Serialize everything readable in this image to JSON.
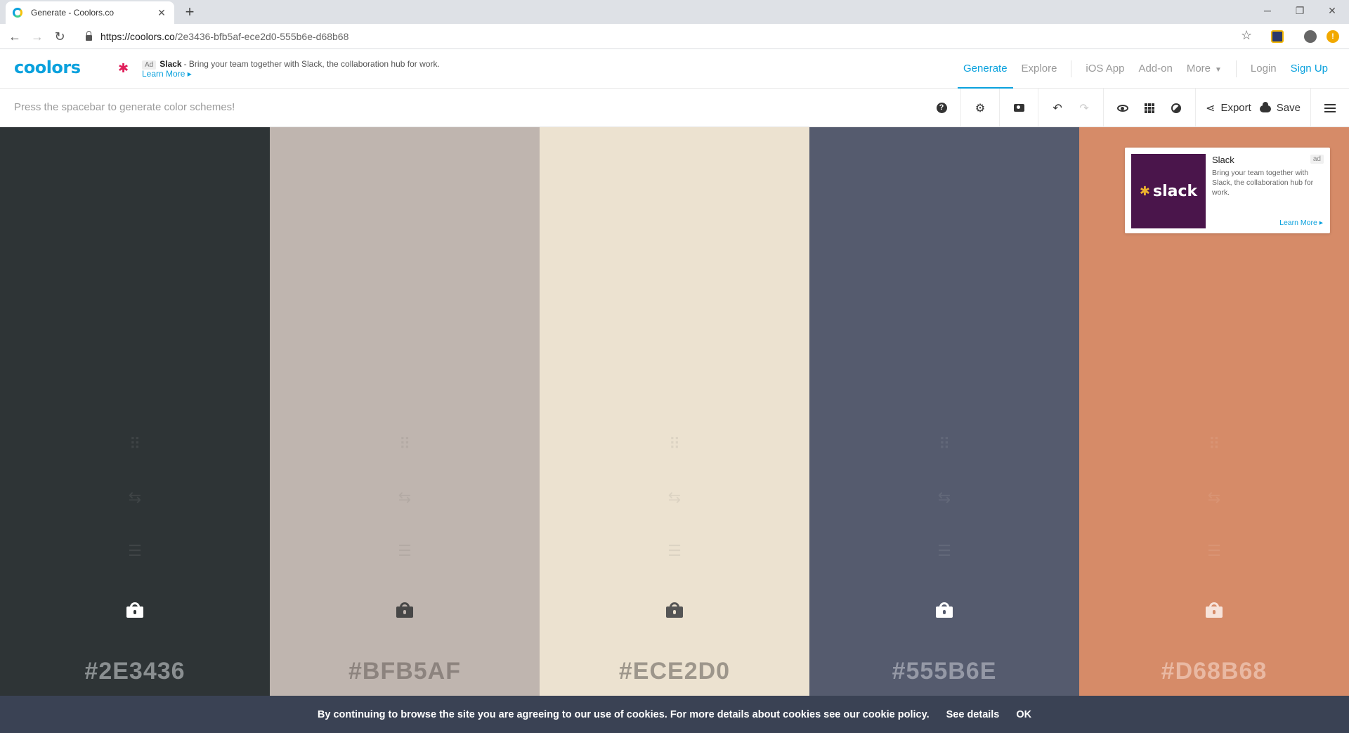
{
  "browser": {
    "tab_title": "Generate - Coolors.co",
    "new_tab": "+",
    "close_tab": "✕",
    "url_host": "https://coolors.co",
    "url_path": "/2e3436-bfb5af-ece2d0-555b6e-d68b68"
  },
  "header": {
    "logo": "coolors",
    "ad": {
      "tag": "Ad",
      "brand": "Slack",
      "text": "- Bring your team together with Slack, the collaboration hub for work.",
      "learn_more": "Learn More ▸"
    },
    "nav": {
      "generate": "Generate",
      "explore": "Explore",
      "ios_app": "iOS App",
      "addon": "Add-on",
      "more": "More",
      "login": "Login",
      "signup": "Sign Up"
    }
  },
  "toolbar": {
    "hint": "Press the spacebar to generate color schemes!",
    "help": "?",
    "export_label": "Export",
    "save_label": "Save"
  },
  "palette": {
    "colors": [
      {
        "hex": "#2E3436",
        "bg": "#2E3436",
        "fg": "#ffffff",
        "lock": "#ffffff",
        "hex_color": "#8a8f91"
      },
      {
        "hex": "#BFB5AF",
        "bg": "#BFB5AF",
        "fg": "#333333",
        "lock": "#474747",
        "hex_color": "#8c837e"
      },
      {
        "hex": "#ECE2D0",
        "bg": "#ECE2D0",
        "fg": "#333333",
        "lock": "#555555",
        "hex_color": "#9d968b"
      },
      {
        "hex": "#555B6E",
        "bg": "#555B6E",
        "fg": "#ffffff",
        "lock": "#ffffff",
        "hex_color": "#9599a6"
      },
      {
        "hex": "#D68B68",
        "bg": "#D68B68",
        "fg": "#ffffff",
        "lock": "#f7e3da",
        "hex_color": "#e9b9a3"
      }
    ]
  },
  "ad_card": {
    "title": "Slack",
    "tag": "ad",
    "image_text": "slack",
    "description": "Bring your team together with Slack, the collaboration hub for work.",
    "learn_more": "Learn More ▸"
  },
  "cookie": {
    "text": "By continuing to browse the site you are agreeing to our use of cookies. For more details about cookies see our cookie policy.",
    "details": "See details",
    "ok": "OK"
  },
  "colors": {
    "accent": "#0aa1dd",
    "cookie_bg": "#3a4254",
    "slack_purple": "#4a154b"
  }
}
